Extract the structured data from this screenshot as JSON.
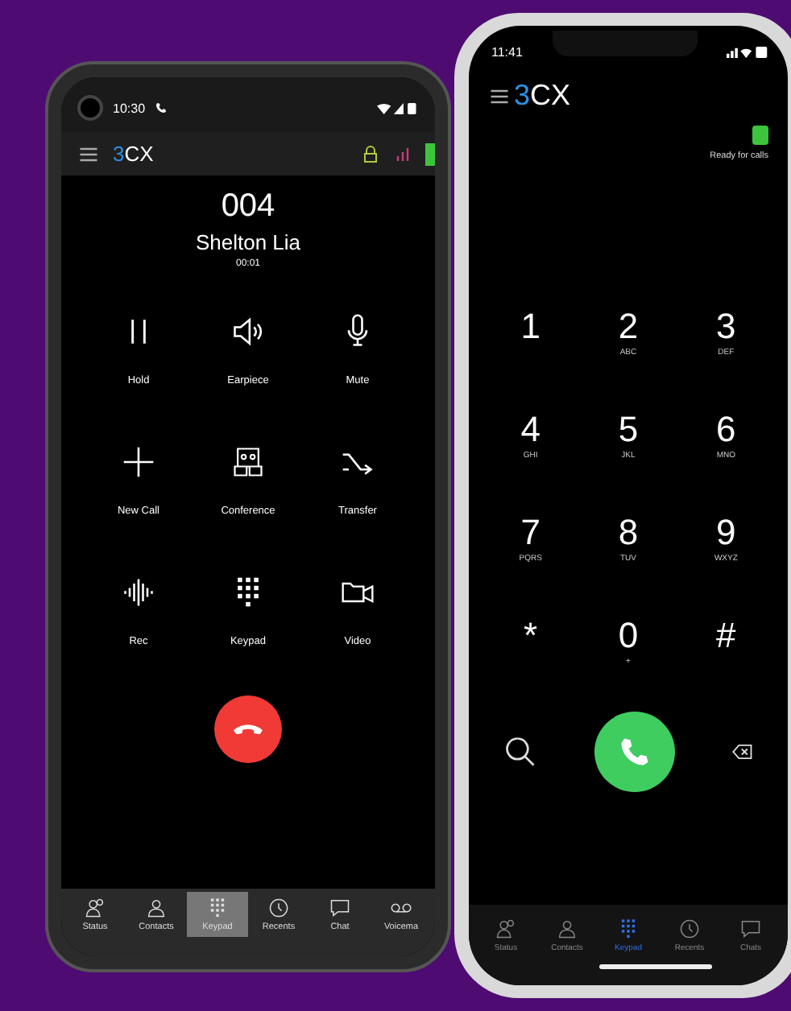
{
  "call_phone": {
    "status_bar": {
      "time": "10:30"
    },
    "app_bar": {
      "logo": "3CX"
    },
    "call": {
      "number": "004",
      "name": "Shelton Lia",
      "duration": "00:01"
    },
    "actions": [
      {
        "label": "Hold",
        "kind": "hold"
      },
      {
        "label": "Earpiece",
        "kind": "speaker"
      },
      {
        "label": "Mute",
        "kind": "mic"
      },
      {
        "label": "New Call",
        "kind": "plus"
      },
      {
        "label": "Conference",
        "kind": "conference"
      },
      {
        "label": "Transfer",
        "kind": "transfer"
      },
      {
        "label": "Rec",
        "kind": "record"
      },
      {
        "label": "Keypad",
        "kind": "keypad"
      },
      {
        "label": "Video",
        "kind": "video"
      }
    ],
    "tabs": [
      {
        "label": "Status",
        "kind": "status",
        "selected": false
      },
      {
        "label": "Contacts",
        "kind": "contacts",
        "selected": false
      },
      {
        "label": "Keypad",
        "kind": "keypad",
        "selected": true
      },
      {
        "label": "Recents",
        "kind": "recents",
        "selected": false
      },
      {
        "label": "Chat",
        "kind": "chat",
        "selected": false
      },
      {
        "label": "Voicema",
        "kind": "voicemail",
        "selected": false
      }
    ]
  },
  "dialer_phone": {
    "status_bar": {
      "time": "11:41"
    },
    "app_bar": {
      "logo": "3CX",
      "status": "Ready for calls"
    },
    "keys": [
      {
        "digit": "1"
      },
      {
        "digit": "2",
        "letters": "ABC"
      },
      {
        "digit": "3",
        "letters": "DEF"
      },
      {
        "digit": "4",
        "letters": "GHI"
      },
      {
        "digit": "5",
        "letters": "JKL"
      },
      {
        "digit": "6",
        "letters": "MNO"
      },
      {
        "digit": "7",
        "letters": "PQRS"
      },
      {
        "digit": "8",
        "letters": "TUV"
      },
      {
        "digit": "9",
        "letters": "WXYZ"
      },
      {
        "digit": "*"
      },
      {
        "digit": "0",
        "letters": "+"
      },
      {
        "digit": "#"
      }
    ],
    "tabs": [
      {
        "label": "Status",
        "kind": "status",
        "selected": false
      },
      {
        "label": "Contacts",
        "kind": "contacts",
        "selected": false
      },
      {
        "label": "Keypad",
        "kind": "keypad",
        "selected": true
      },
      {
        "label": "Recents",
        "kind": "recents",
        "selected": false
      },
      {
        "label": "Chats",
        "kind": "chat",
        "selected": false
      }
    ]
  }
}
